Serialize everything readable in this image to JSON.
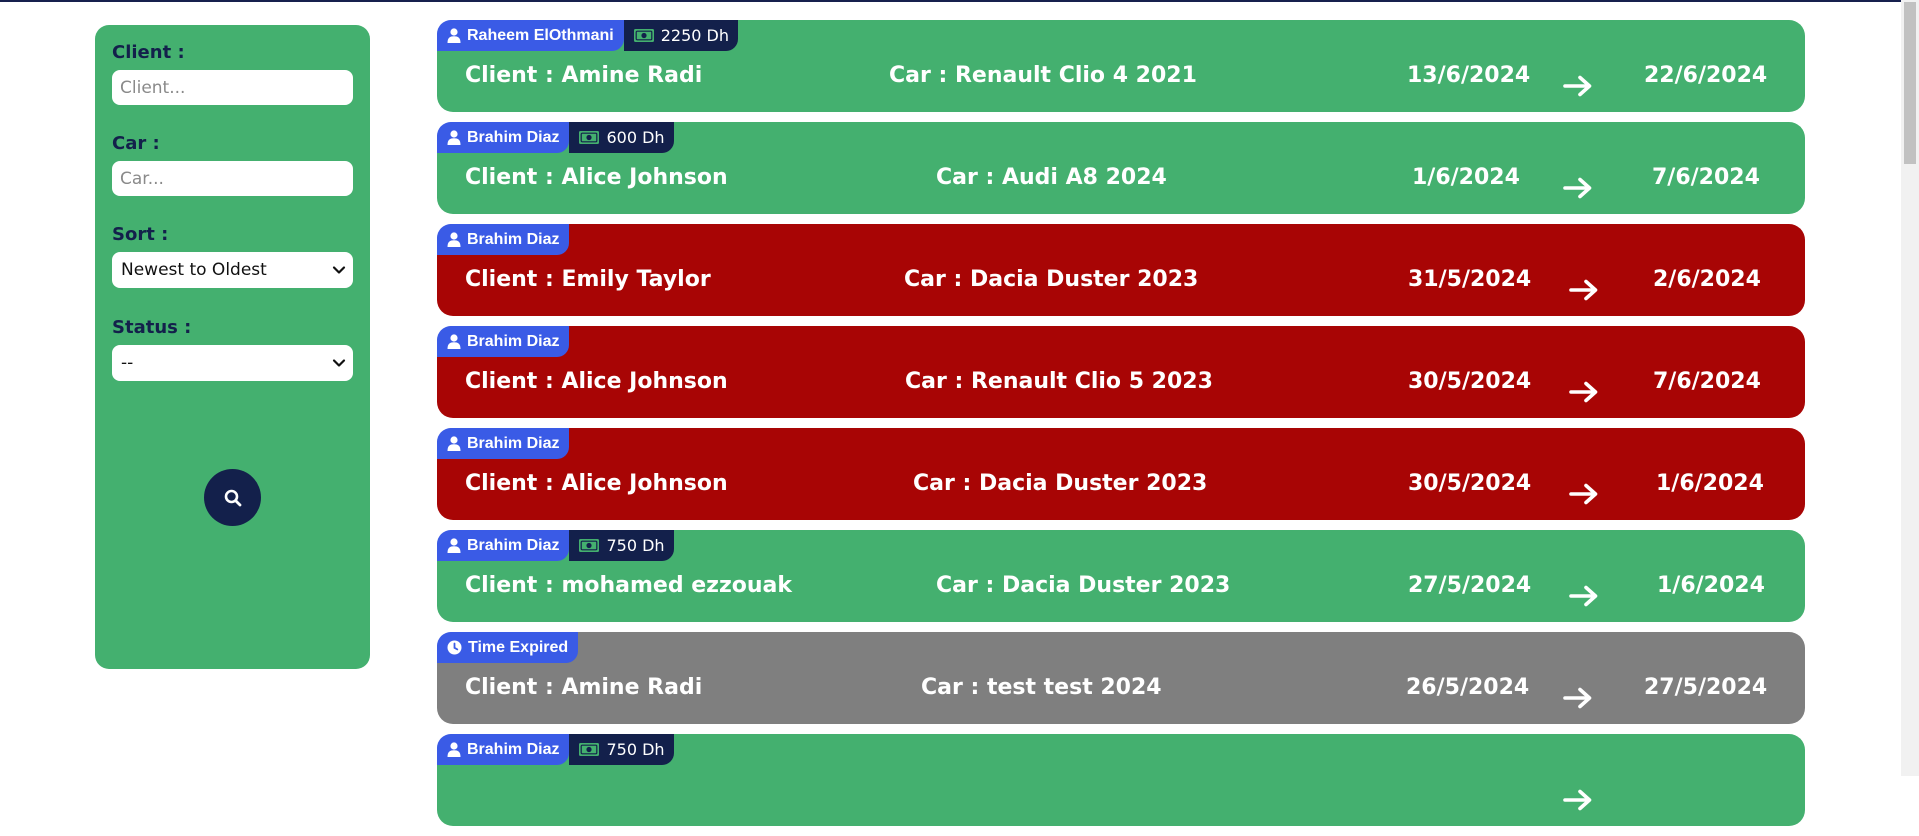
{
  "filters": {
    "client_label": "Client :",
    "client_placeholder": "Client...",
    "car_label": "Car :",
    "car_placeholder": "Car...",
    "sort_label": "Sort :",
    "sort_value": "Newest to Oldest",
    "status_label": "Status :",
    "status_value": "--",
    "search_icon": "search-icon"
  },
  "colors": {
    "active": "#44b06f",
    "cancelled": "#a80505",
    "expired": "#7f7f7f",
    "agent_tag": "#3a5be6",
    "price_tag": "#13204b"
  },
  "bookings": [
    {
      "status": "green",
      "agent": "Raheem ElOthmani",
      "tag_icon": "user-icon",
      "price": "2250 Dh",
      "client": "Client : Amine Radi",
      "car": "Car : Renault Clio 4 2021",
      "start": "13/6/2024",
      "end": "22/6/2024"
    },
    {
      "status": "green",
      "agent": "Brahim Diaz",
      "tag_icon": "user-icon",
      "price": "600 Dh",
      "client": "Client : Alice Johnson",
      "car": "Car : Audi A8 2024",
      "start": "1/6/2024",
      "end": "7/6/2024"
    },
    {
      "status": "red",
      "agent": "Brahim Diaz",
      "tag_icon": "user-icon",
      "price": "",
      "client": "Client : Emily Taylor",
      "car": "Car : Dacia Duster 2023",
      "start": "31/5/2024",
      "end": "2/6/2024"
    },
    {
      "status": "red",
      "agent": "Brahim Diaz",
      "tag_icon": "user-icon",
      "price": "",
      "client": "Client : Alice Johnson",
      "car": "Car : Renault Clio 5 2023",
      "start": "30/5/2024",
      "end": "7/6/2024"
    },
    {
      "status": "red",
      "agent": "Brahim Diaz",
      "tag_icon": "user-icon",
      "price": "",
      "client": "Client : Alice Johnson",
      "car": "Car : Dacia Duster 2023",
      "start": "30/5/2024",
      "end": "1/6/2024"
    },
    {
      "status": "green",
      "agent": "Brahim Diaz",
      "tag_icon": "user-icon",
      "price": "750 Dh",
      "client": "Client : mohamed ezzouak",
      "car": "Car : Dacia Duster 2023",
      "start": "27/5/2024",
      "end": "1/6/2024"
    },
    {
      "status": "gray",
      "agent": "Time Expired",
      "tag_icon": "clock-icon",
      "price": "",
      "client": "Client : Amine Radi",
      "car": "Car : test test 2024",
      "start": "26/5/2024",
      "end": "27/5/2024"
    },
    {
      "status": "green",
      "agent": "Brahim Diaz",
      "tag_icon": "user-icon",
      "price": "750 Dh",
      "client": "",
      "car": "",
      "start": "",
      "end": ""
    }
  ]
}
